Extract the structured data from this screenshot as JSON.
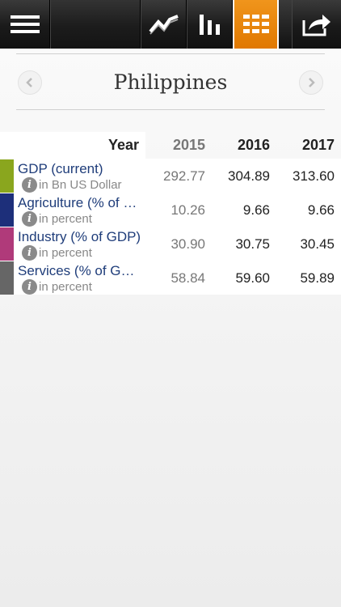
{
  "toolbar": {
    "icons": [
      "menu-icon",
      "line-chart-icon",
      "bar-chart-icon",
      "table-icon",
      "share-icon"
    ],
    "active": "table",
    "active_color": "#e88400"
  },
  "title": "Philippines",
  "table": {
    "year_header": "Year",
    "years": [
      "2015",
      "2016",
      "2017"
    ],
    "rows": [
      {
        "name": "GDP (current)",
        "unit": "in Bn US Dollar",
        "color": "#8aa61e",
        "values": [
          "292.77",
          "304.89",
          "313.60"
        ]
      },
      {
        "name": "Agriculture (% of GDP)",
        "unit": "in percent",
        "color": "#1d2f7a",
        "values": [
          "10.26",
          "9.66",
          "9.66"
        ]
      },
      {
        "name": "Industry (% of GDP)",
        "unit": "in percent",
        "color": "#b03a7a",
        "values": [
          "30.90",
          "30.75",
          "30.45"
        ]
      },
      {
        "name": "Services (% of GDP)",
        "unit": "in percent",
        "color": "#666666",
        "values": [
          "58.84",
          "59.60",
          "59.89"
        ]
      }
    ]
  }
}
